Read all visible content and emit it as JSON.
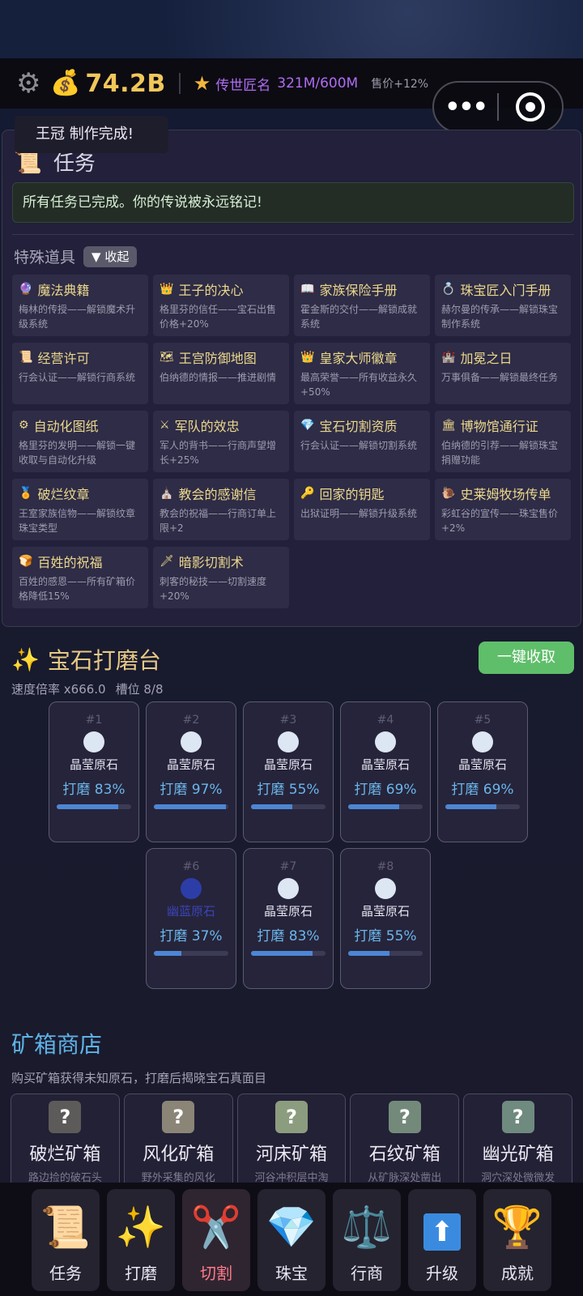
{
  "status_bar": {
    "gold": "74.2B",
    "fame_label": "传世匠名",
    "fame_value": "321M/600M",
    "price_bonus": "售价+12%"
  },
  "toast": "王冠 制作完成!",
  "tasks": {
    "title": "任务",
    "completed_message": "所有任务已完成。你的传说被永远铭记!",
    "special_items_label": "特殊道具",
    "collapse_label": "▼ 收起",
    "items": [
      {
        "icon": "🔮",
        "name": "魔法典籍",
        "desc": "梅林的传授——解锁魔术升级系统"
      },
      {
        "icon": "👑",
        "name": "王子的决心",
        "desc": "格里芬的信任——宝石出售价格+20%"
      },
      {
        "icon": "📖",
        "name": "家族保险手册",
        "desc": "霍金斯的交付——解锁成就系统"
      },
      {
        "icon": "💍",
        "name": "珠宝匠入门手册",
        "desc": "赫尔曼的传承——解锁珠宝制作系统"
      },
      {
        "icon": "📜",
        "name": "经营许可",
        "desc": "行会认证——解锁行商系统"
      },
      {
        "icon": "🗺",
        "name": "王宫防御地图",
        "desc": "伯纳德的情报——推进剧情"
      },
      {
        "icon": "👑",
        "name": "皇家大师徽章",
        "desc": "最高荣誉——所有收益永久+50%"
      },
      {
        "icon": "🏰",
        "name": "加冕之日",
        "desc": "万事俱备——解锁最终任务"
      },
      {
        "icon": "⚙",
        "name": "自动化图纸",
        "desc": "格里芬的发明——解锁一键收取与自动化升级"
      },
      {
        "icon": "⚔",
        "name": "军队的效忠",
        "desc": "军人的背书——行商声望增长+25%"
      },
      {
        "icon": "💎",
        "name": "宝石切割资质",
        "desc": "行会认证——解锁切割系统"
      },
      {
        "icon": "🏛",
        "name": "博物馆通行证",
        "desc": "伯纳德的引荐——解锁珠宝捐赠功能"
      },
      {
        "icon": "🏅",
        "name": "破烂纹章",
        "desc": "王室家族信物——解锁纹章珠宝类型"
      },
      {
        "icon": "⛪",
        "name": "教会的感谢信",
        "desc": "教会的祝福——行商订单上限+2"
      },
      {
        "icon": "🔑",
        "name": "回家的钥匙",
        "desc": "出狱证明——解锁升级系统"
      },
      {
        "icon": "🐌",
        "name": "史莱姆牧场传单",
        "desc": "彩虹谷的宣传——珠宝售价+2%"
      },
      {
        "icon": "🍞",
        "name": "百姓的祝福",
        "desc": "百姓的感恩——所有矿箱价格降低15%"
      },
      {
        "icon": "🗡",
        "name": "暗影切割术",
        "desc": "刺客的秘技——切割速度+20%"
      }
    ]
  },
  "grinding": {
    "title": "宝石打磨台",
    "collect_all": "一键收取",
    "speed": "速度倍率 x666.0",
    "slots_label": "槽位 8/8",
    "slots": [
      {
        "num": "#1",
        "name": "晶莹原石",
        "progress_text": "打磨 83%",
        "progress": 83,
        "color": "white"
      },
      {
        "num": "#2",
        "name": "晶莹原石",
        "progress_text": "打磨 97%",
        "progress": 97,
        "color": "white"
      },
      {
        "num": "#3",
        "name": "晶莹原石",
        "progress_text": "打磨 55%",
        "progress": 55,
        "color": "white"
      },
      {
        "num": "#4",
        "name": "晶莹原石",
        "progress_text": "打磨 69%",
        "progress": 69,
        "color": "white"
      },
      {
        "num": "#5",
        "name": "晶莹原石",
        "progress_text": "打磨 69%",
        "progress": 69,
        "color": "white"
      },
      {
        "num": "#6",
        "name": "幽蓝原石",
        "progress_text": "打磨 37%",
        "progress": 37,
        "color": "blue"
      },
      {
        "num": "#7",
        "name": "晶莹原石",
        "progress_text": "打磨 83%",
        "progress": 83,
        "color": "white"
      },
      {
        "num": "#8",
        "name": "晶莹原石",
        "progress_text": "打磨 55%",
        "progress": 55,
        "color": "white"
      }
    ]
  },
  "shop": {
    "title": "矿箱商店",
    "subtitle": "购买矿箱获得未知原石，打磨后揭晓宝石真面目",
    "boxes": [
      {
        "name": "破烂矿箱",
        "desc": "路边捡的破石头",
        "color": "#5d5a5a"
      },
      {
        "name": "风化矿箱",
        "desc": "野外采集的风化",
        "color": "#8a8576"
      },
      {
        "name": "河床矿箱",
        "desc": "河谷冲积层中淘",
        "color": "#8c9c7e"
      },
      {
        "name": "石纹矿箱",
        "desc": "从矿脉深处凿出",
        "color": "#738a7b"
      },
      {
        "name": "幽光矿箱",
        "desc": "洞穴深处微微发",
        "color": "#6f8a7f"
      }
    ]
  },
  "nav": [
    {
      "label": "任务",
      "icon": "📜"
    },
    {
      "label": "打磨",
      "icon": "✨"
    },
    {
      "label": "切割",
      "icon": "✂️"
    },
    {
      "label": "珠宝",
      "icon": "💎"
    },
    {
      "label": "行商",
      "icon": "⚖️"
    },
    {
      "label": "升级",
      "icon": "⬆"
    },
    {
      "label": "成就",
      "icon": "🏆"
    }
  ]
}
